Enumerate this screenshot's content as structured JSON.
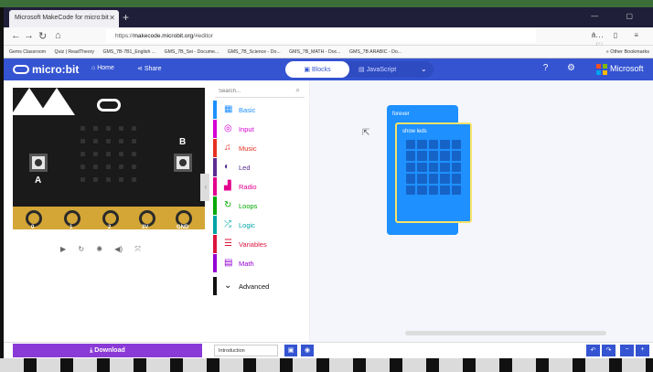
{
  "browser": {
    "tab_title": "Microsoft MakeCode for micro:bit",
    "new_tab": "+",
    "window_controls": "— ▢",
    "url_prefix": "https://",
    "url_host": "makecode.microbit.org",
    "url_path": "/#editor",
    "url_menu": "··· ♡ ☆",
    "right_tools": "⋔ ▯ ≡",
    "bookmarks": [
      "Gems Classroom",
      "Quiz | ReadTheory",
      "GMS_7B-7B1_English ...",
      "GMS_7B_Sei - Docume...",
      "GMS_7B_Science - Do...",
      "GMS_7B_MATH - Doc...",
      "GMS_7B ARABIC - Do..."
    ],
    "other_bookmarks": "» Other Bookmarks"
  },
  "header": {
    "logo": "micro:bit",
    "home": "Home",
    "share": "Share",
    "blocks": "Blocks",
    "javascript": "JavaScript",
    "microsoft": "Microsoft",
    "accent": "#3454d1"
  },
  "simulator": {
    "pins": [
      "0",
      "1",
      "2",
      "3V",
      "GND"
    ],
    "button_a": "A",
    "button_b": "B"
  },
  "toolbox": {
    "search_placeholder": "Search...",
    "categories": [
      {
        "label": "Basic",
        "icon": "grid-icon",
        "color": "#1e90ff"
      },
      {
        "label": "Input",
        "icon": "target-icon",
        "color": "#d400d4"
      },
      {
        "label": "Music",
        "icon": "headphones-icon",
        "color": "#e63022"
      },
      {
        "label": "Led",
        "icon": "toggle-icon",
        "color": "#5c2d91"
      },
      {
        "label": "Radio",
        "icon": "signal-icon",
        "color": "#e3008c"
      },
      {
        "label": "Loops",
        "icon": "refresh-icon",
        "color": "#00aa00"
      },
      {
        "label": "Logic",
        "icon": "shuffle-icon",
        "color": "#00a4a6"
      },
      {
        "label": "Variables",
        "icon": "list-icon",
        "color": "#dc143c"
      },
      {
        "label": "Math",
        "icon": "calculator-icon",
        "color": "#9400d3"
      },
      {
        "label": "Advanced",
        "icon": "chevron-down-icon",
        "color": "#111111"
      }
    ]
  },
  "workspace": {
    "forever_label": "forever",
    "show_leds_label": "show leds"
  },
  "footer": {
    "download": "Download",
    "project_name": "Introduction"
  }
}
